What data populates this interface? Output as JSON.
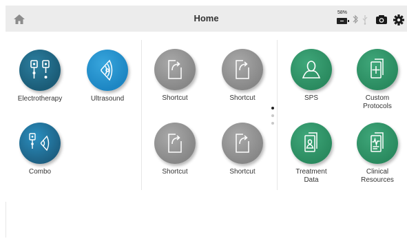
{
  "header": {
    "title": "Home",
    "battery_percent": "58%",
    "icons": [
      "home-icon",
      "battery-icon",
      "bluetooth-icon",
      "usb-icon",
      "camera-icon",
      "settings-gear-icon"
    ]
  },
  "colors": {
    "header_bg": "#ececec",
    "electro_blue": "#1b5c77",
    "ultrasound_blue": "#1d86c3",
    "shortcut_gray": "#878787",
    "green": "#2a8a5f"
  },
  "left_panel": {
    "tiles": [
      {
        "label": "Electrotherapy",
        "icon": "electrotherapy-icon"
      },
      {
        "label": "Ultrasound",
        "icon": "ultrasound-icon"
      },
      {
        "label": "Combo",
        "icon": "combo-icon"
      }
    ]
  },
  "middle_panel": {
    "tiles": [
      {
        "label": "Shortcut",
        "icon": "shortcut-icon"
      },
      {
        "label": "Shortcut",
        "icon": "shortcut-icon"
      },
      {
        "label": "Shortcut",
        "icon": "shortcut-icon"
      },
      {
        "label": "Shortcut",
        "icon": "shortcut-icon"
      }
    ],
    "pager": {
      "pages": 3,
      "current": 1
    }
  },
  "right_panel": {
    "tiles": [
      {
        "label": "SPS",
        "icon": "sps-person-icon"
      },
      {
        "label": "Custom\nProtocols",
        "icon": "custom-protocols-icon"
      },
      {
        "label": "Treatment\nData",
        "icon": "treatment-data-icon"
      },
      {
        "label": "Clinical\nResources",
        "icon": "clinical-resources-icon"
      }
    ]
  }
}
